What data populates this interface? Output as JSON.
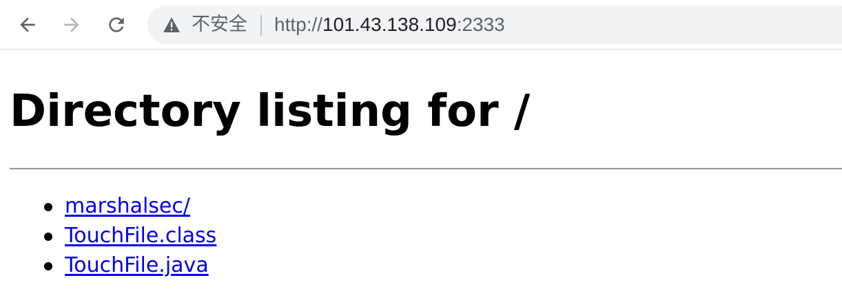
{
  "browser": {
    "insecure_label": "不安全",
    "url_scheme": "http://",
    "url_host": "101.43.138.109",
    "url_port": ":2333"
  },
  "page": {
    "title": "Directory listing for /",
    "items": [
      {
        "label": "marshalsec/"
      },
      {
        "label": "TouchFile.class"
      },
      {
        "label": "TouchFile.java"
      }
    ]
  },
  "colors": {
    "link": "#0000ee",
    "omnibox_bg": "#f1f3f4",
    "icon_gray": "#5f6368"
  }
}
